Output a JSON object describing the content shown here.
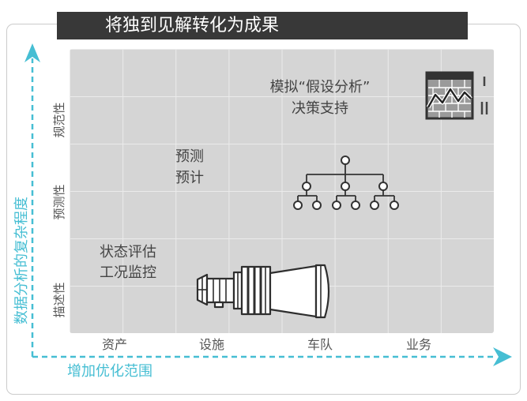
{
  "title": "将独到见解转化为成果",
  "axes": {
    "y_title": "数据分析的复杂程度",
    "x_title": "增加优化范围",
    "rows": [
      "规范性",
      "预测性",
      "描述性"
    ],
    "columns": [
      "资产",
      "设施",
      "车队",
      "业务"
    ]
  },
  "annotations": {
    "prescriptive": [
      "模拟“假设分析”",
      "决策支持"
    ],
    "predictive": [
      "预测",
      "预计"
    ],
    "descriptive": [
      "状态评估",
      "工况监控"
    ]
  },
  "icons": {
    "prescriptive": "spreadsheet-chart-icon",
    "predictive": "hierarchy-tree-icon",
    "descriptive": "jet-engine-icon"
  },
  "colors": {
    "accent": "#46bed3",
    "banner": "#383838",
    "grid": "#d5d5d5",
    "text": "#4a4a4a"
  }
}
